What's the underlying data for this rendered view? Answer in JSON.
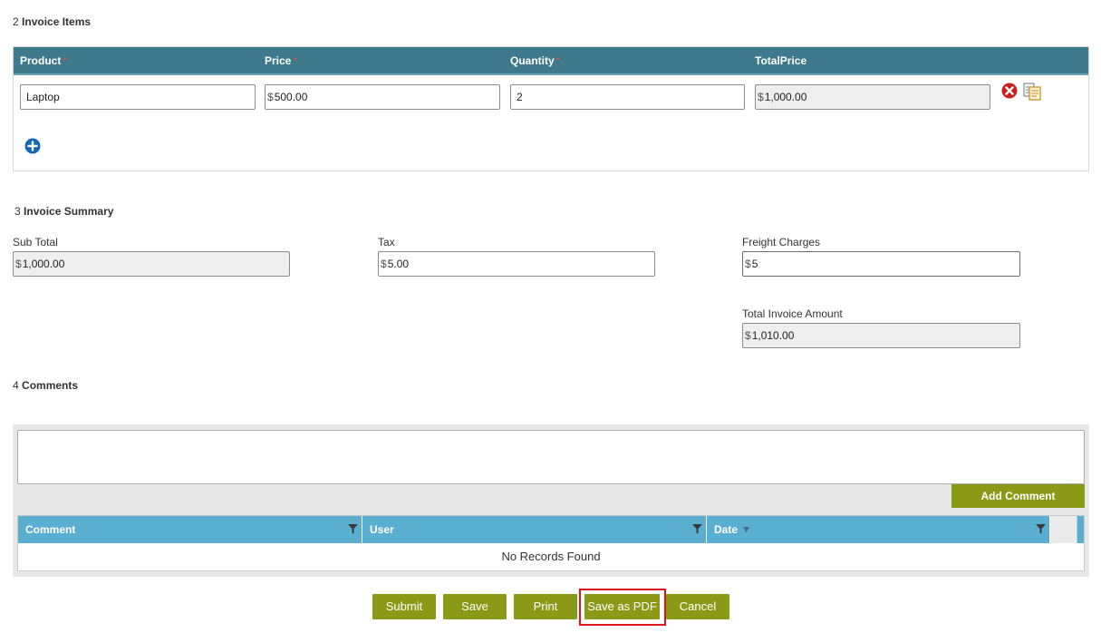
{
  "sections": {
    "items": {
      "num": "2",
      "title": "Invoice Items"
    },
    "summary": {
      "num": "3",
      "title": "Invoice Summary"
    },
    "comments": {
      "num": "4",
      "title": "Comments"
    }
  },
  "items_table": {
    "headers": {
      "product": "Product",
      "price": "Price",
      "quantity": "Quantity",
      "total": "TotalPrice"
    },
    "required_mark": "*",
    "row": {
      "product": "Laptop",
      "currency": "$",
      "price": "500.00",
      "quantity": "2",
      "total": "1,000.00"
    },
    "icons": {
      "remove": "remove-circle-icon",
      "copy": "copy-document-icon",
      "add": "add-circle-icon"
    }
  },
  "summary": {
    "currency": "$",
    "sub_total_label": "Sub Total",
    "sub_total": "1,000.00",
    "tax_label": "Tax",
    "tax": "5.00",
    "freight_label": "Freight Charges",
    "freight": "5",
    "total_label": "Total Invoice Amount",
    "total": "1,010.00"
  },
  "comments": {
    "add_button": "Add Comment",
    "columns": {
      "comment": "Comment",
      "user": "User",
      "date": "Date"
    },
    "empty_text": "No Records Found"
  },
  "actions": {
    "submit": "Submit",
    "save": "Save",
    "print": "Print",
    "save_pdf": "Save as PDF",
    "cancel": "Cancel"
  },
  "colors": {
    "header_teal": "#3f7a8c",
    "grid_header_blue": "#5aafd0",
    "button_olive": "#8a9a16",
    "highlight_red": "#e0141e"
  }
}
